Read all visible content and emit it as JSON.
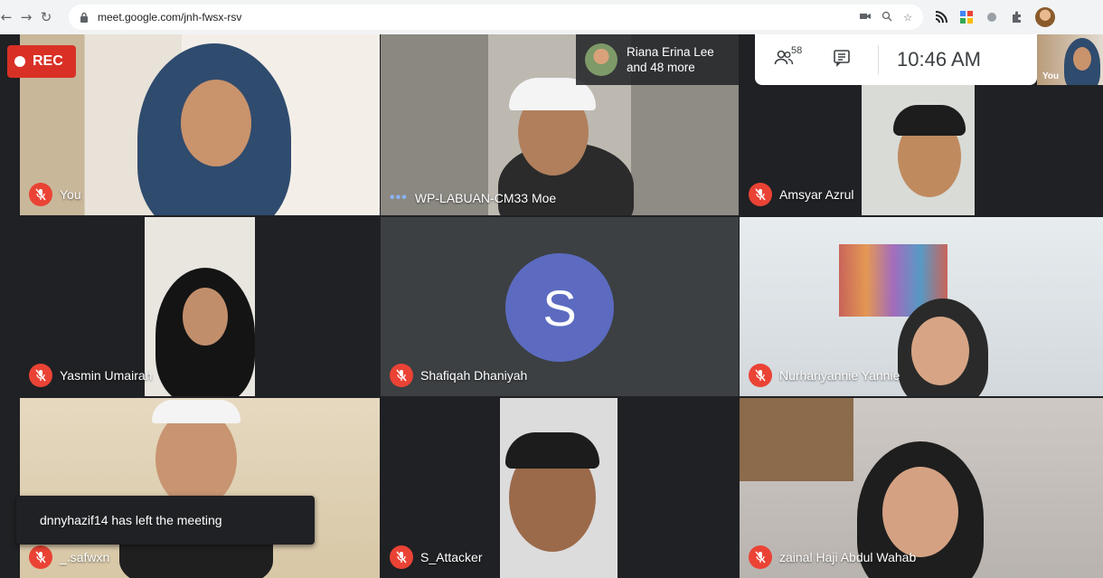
{
  "browser": {
    "url": "meet.google.com/jnh-fwsx-rsv"
  },
  "meeting": {
    "rec_label": "REC",
    "presence": {
      "line1": "Riana Erina Lee",
      "line2": "and 48 more"
    },
    "participant_count": "58",
    "clock": "10:46 AM",
    "self_view_label": "You",
    "toast": "dnnyhazif14 has left the meeting",
    "tiles": [
      {
        "name": "You"
      },
      {
        "name": "WP-LABUAN-CM33 Moe"
      },
      {
        "name": "Amsyar Azrul"
      },
      {
        "name": "Yasmin Umairah"
      },
      {
        "name": "Shafiqah Dhaniyah",
        "avatar_letter": "S"
      },
      {
        "name": "Nurhariyannie Yannie"
      },
      {
        "name": "_.safwxn"
      },
      {
        "name": "S_Attacker"
      },
      {
        "name": "zainal Haji Abdul Wahab"
      }
    ]
  },
  "colors": {
    "stage_bg": "#202124",
    "mic_off": "#ea4335",
    "rec": "#d93025",
    "avatar": "#5c6bc0"
  }
}
